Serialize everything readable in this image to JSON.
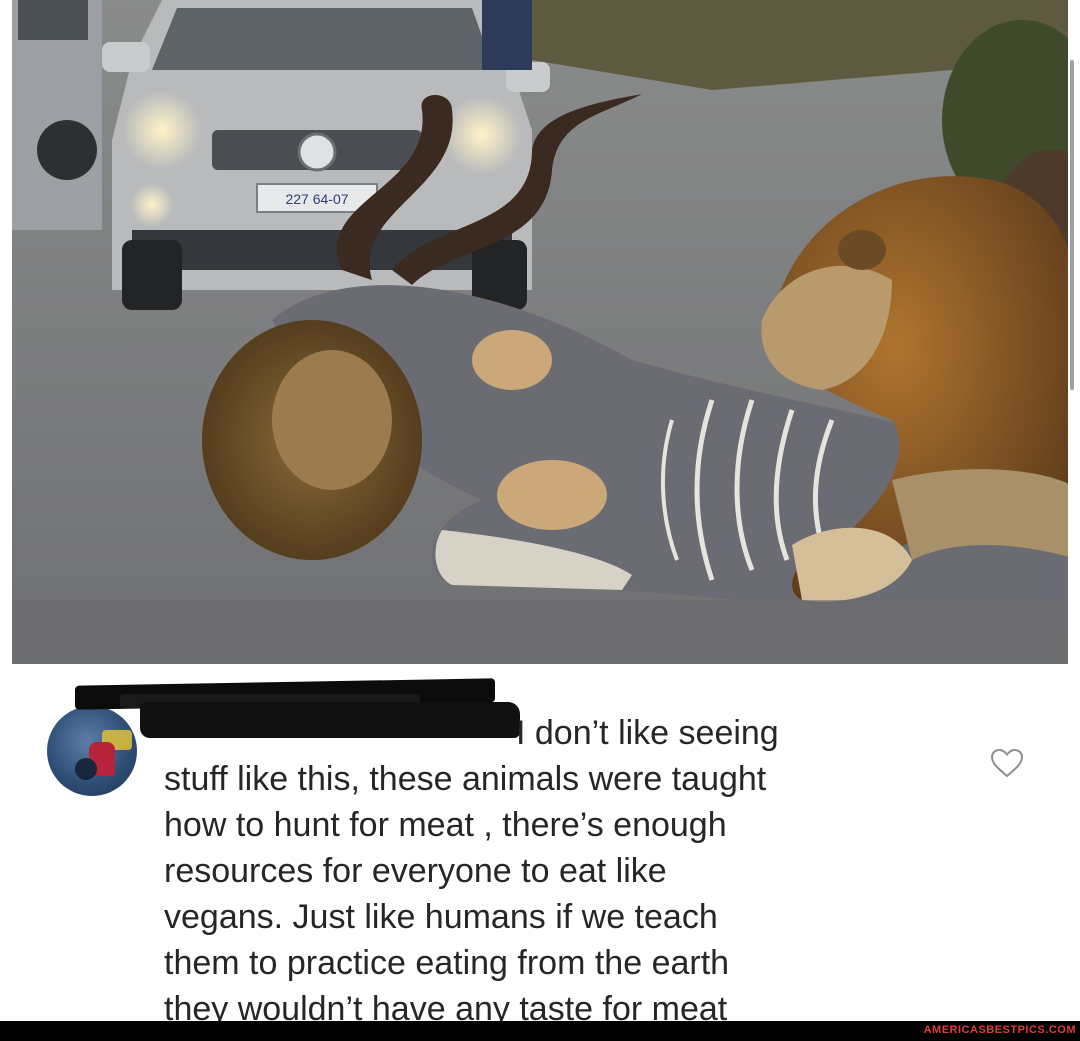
{
  "post": {
    "photo_icon": "safari-lions-on-road-photo"
  },
  "comment": {
    "avatar_icon": "user-avatar-icon",
    "redacted_username_icon": "redacted-username-icon",
    "lines": [
      "I don’t like seeing",
      "stuff like this, these animals were taught",
      "how to hunt for meat , there’s enough",
      "resources for everyone to eat like",
      "vegans. Just like humans if we teach",
      "them to practice eating from the earth",
      "they wouldn’t have any taste for meat"
    ],
    "like_icon": "heart-icon"
  },
  "car": {
    "plate": "227 64-07"
  },
  "watermark": {
    "text": "AMERICASBESTPICS.COM"
  },
  "colors": {
    "text": "#262626",
    "heart_stroke": "#8e8e8e",
    "watermark": "#e23b3b",
    "redaction": "#0b0b0b"
  }
}
